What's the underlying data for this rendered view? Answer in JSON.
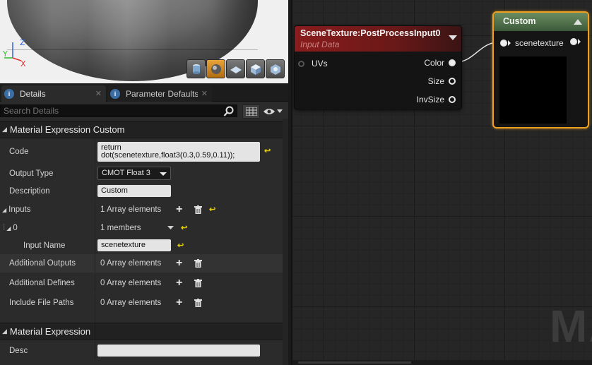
{
  "viewport": {
    "axis_z": "Z",
    "axis_x": "X",
    "axis_y": "Y",
    "buttons": [
      "cylinder-icon",
      "sphere-icon",
      "plane-icon",
      "cube-icon",
      "custom-mesh-icon"
    ],
    "active_button": "sphere-icon"
  },
  "tabs": [
    {
      "label": "Details",
      "close": "✕",
      "icon": "details-icon"
    },
    {
      "label": "Parameter Defaults",
      "close": "✕",
      "icon": "details-icon"
    }
  ],
  "search": {
    "placeholder": "Search Details"
  },
  "sections": {
    "custom": "Material Expression Custom",
    "expression": "Material Expression"
  },
  "props": {
    "code_label": "Code",
    "code_value": "return dot(scenetexture,float3(0.3,0.59,0.11));",
    "output_type_label": "Output Type",
    "output_type_value": "CMOT Float 3",
    "description_label": "Description",
    "description_value": "Custom",
    "inputs_label": "Inputs",
    "inputs_value": "1 Array elements",
    "index0_label": "0",
    "index0_value": "1 members",
    "input_name_label": "Input Name",
    "input_name_value": "scenetexture",
    "additional_outputs_label": "Additional Outputs",
    "additional_outputs_value": "0 Array elements",
    "additional_defines_label": "Additional Defines",
    "additional_defines_value": "0 Array elements",
    "include_paths_label": "Include File Paths",
    "include_paths_value": "0 Array elements",
    "desc_label": "Desc",
    "desc_value": ""
  },
  "graph": {
    "scenetexture_node": {
      "title": "SceneTexture:PostProcessInput0",
      "subtitle": "Input Data",
      "input_pin": "UVs",
      "outputs": [
        "Color",
        "Size",
        "InvSize"
      ]
    },
    "custom_node": {
      "title": "Custom",
      "input_pin": "scenetexture"
    },
    "watermark": "MA"
  },
  "colors": {
    "accent_selected": "#f0a020",
    "reset_arrow": "#e8d000",
    "scenetexture_header": "#8a1c1c",
    "custom_header": "#4f7048"
  }
}
